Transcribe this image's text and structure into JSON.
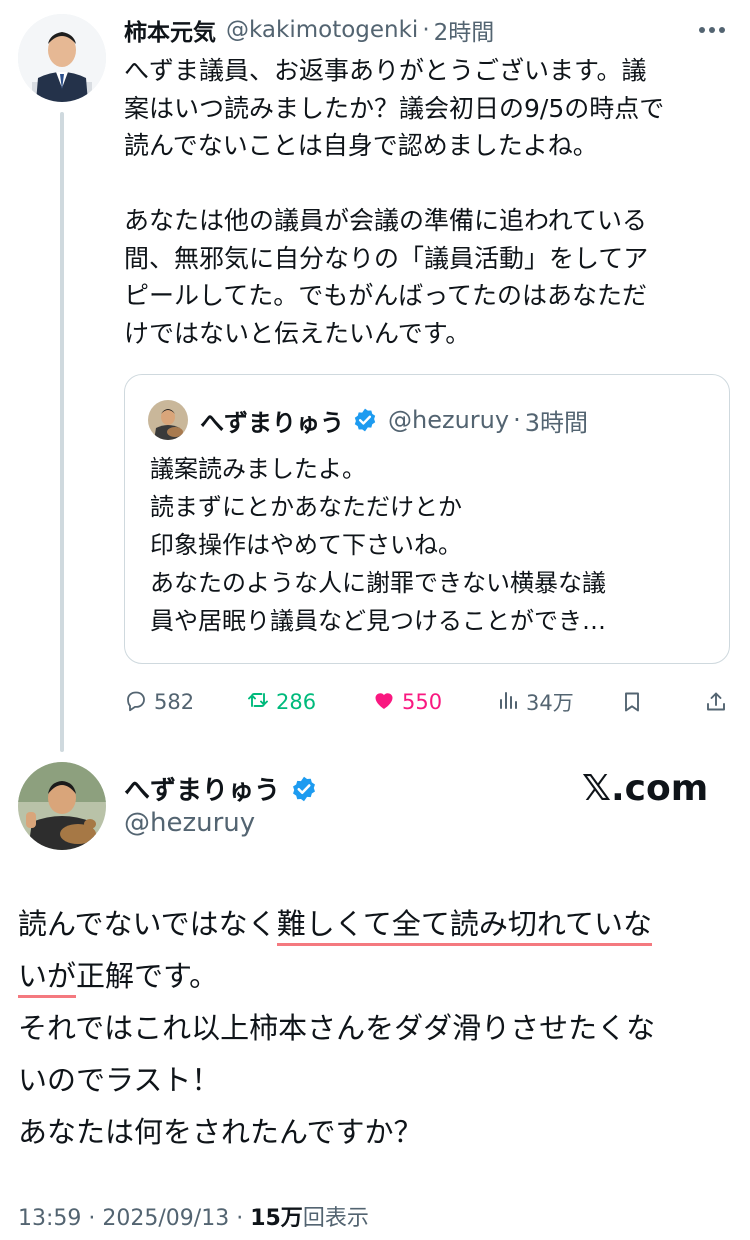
{
  "tweet1": {
    "display_name": "柿本元気",
    "handle": "@kakimotogenki",
    "separator": "·",
    "time": "2時間",
    "body": "へずま議員、お返事ありがとうございます。議\n案はいつ読みましたか？議会初日の9/5の時点で\n読んでないことは自身で認めましたよね。\n\nあなたは他の議員が会議の準備に追われている\n間、無邪気に自分なりの「議員活動」をしてア\nピールしてた。でもがんばってたのはあなただ\nけではないと伝えたいんです。"
  },
  "quote": {
    "display_name": "へずまりゅう",
    "handle": "@hezuruy",
    "separator": "·",
    "time": "3時間",
    "body": "議案読みましたよ。\n読まずにとかあなただけとか\n印象操作はやめて下さいね。\nあなたのような人に謝罪できない横暴な議\n員や居眠り議員など見つけることができ…"
  },
  "actions": {
    "replies": "582",
    "retweets": "286",
    "likes": "550",
    "views": "34万"
  },
  "tweet2": {
    "display_name": "へずまりゅう",
    "handle": "@hezuruy",
    "watermark": "𝕏.com",
    "line1_a": "読んでないではなく",
    "line1_b": "難しくて全て読み切れていな",
    "line2_a": "いが",
    "line2_b": "正解です。",
    "line3": "それではこれ以上柿本さんをダダ滑りさせたくな",
    "line4": "いのでラスト！",
    "line5": "あなたは何をされたんですか？"
  },
  "footer": {
    "time": "13:59",
    "sep1": " · ",
    "date": "2025/09/13",
    "sep2": " · ",
    "views_count": "15万",
    "views_label": "回表示"
  },
  "colors": {
    "text": "#0f1419",
    "secondary": "#536471",
    "retweet": "#00ba7c",
    "like": "#f91880",
    "verified": "#1d9bf0",
    "underline": "#f4797f"
  },
  "icons": [
    "more-icon",
    "verified-icon",
    "reply-icon",
    "retweet-icon",
    "like-icon",
    "views-icon",
    "bookmark-icon",
    "share-icon"
  ]
}
